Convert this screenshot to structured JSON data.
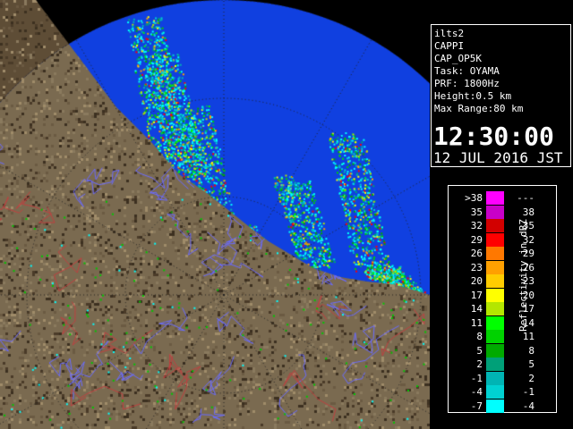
{
  "info": {
    "lines": [
      "ilts2",
      "CAPPI",
      "CAP_OP5K",
      "Task: OYAMA",
      "PRF: 1800Hz",
      "Height:0.5 km",
      "Max Range:80 km"
    ],
    "time": "12:30:00",
    "date": "12 JUL 2016 JST"
  },
  "legend": {
    "title": "Reflectivity in dBZ",
    "rows": [
      {
        "low": ">38",
        "high": "---",
        "color": "#ff00ff"
      },
      {
        "low": "35",
        "high": "38",
        "color": "#c800c8"
      },
      {
        "low": "32",
        "high": "35",
        "color": "#d20000"
      },
      {
        "low": "29",
        "high": "32",
        "color": "#ff0000"
      },
      {
        "low": "26",
        "high": "29",
        "color": "#ff7800"
      },
      {
        "low": "23",
        "high": "26",
        "color": "#ffa000"
      },
      {
        "low": "20",
        "high": "23",
        "color": "#ffcc00"
      },
      {
        "low": "17",
        "high": "20",
        "color": "#ffff00"
      },
      {
        "low": "14",
        "high": "17",
        "color": "#b4e600"
      },
      {
        "low": "11",
        "high": "14",
        "color": "#00ff00"
      },
      {
        "low": "8",
        "high": "11",
        "color": "#00d200"
      },
      {
        "low": "5",
        "high": "8",
        "color": "#00aa00"
      },
      {
        "low": "2",
        "high": "5",
        "color": "#00a078"
      },
      {
        "low": "-1",
        "high": "2",
        "color": "#00b4b4"
      },
      {
        "low": "-4",
        "high": "-1",
        "color": "#00d2d2"
      },
      {
        "low": "-7",
        "high": "-4",
        "color": "#00ffff"
      }
    ]
  },
  "map": {
    "background_color": "#000000",
    "land_color": "#7a6a50",
    "sea_color": "#1040e0",
    "river_color": "#6a6aff",
    "boundary_color": "#c04040",
    "range_ring_color": "#000000"
  }
}
